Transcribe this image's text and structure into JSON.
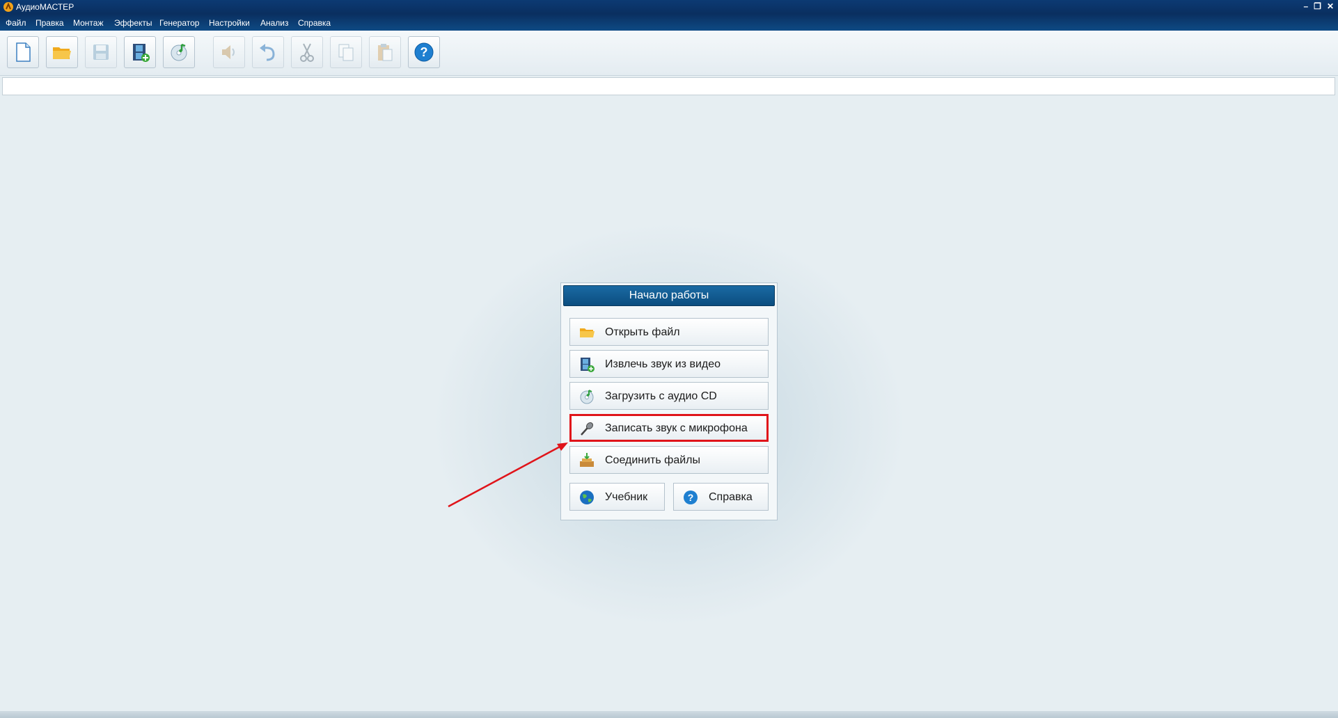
{
  "window": {
    "title": "АудиоМАСТЕР",
    "controls": [
      "–",
      "❐",
      "✕"
    ]
  },
  "menu": [
    "Файл",
    "Правка",
    "Монтаж",
    "Эффекты",
    "Генератор",
    "Настройки",
    "Анализ",
    "Справка"
  ],
  "toolbar": [
    {
      "icon": "new-file-icon",
      "enabled": true
    },
    {
      "icon": "open-folder-icon",
      "enabled": true
    },
    {
      "icon": "save-icon",
      "enabled": false
    },
    {
      "icon": "video-add-icon",
      "enabled": true
    },
    {
      "icon": "audio-cd-icon",
      "enabled": true
    },
    {
      "icon": "speaker-icon",
      "enabled": false
    },
    {
      "icon": "undo-icon",
      "enabled": false
    },
    {
      "icon": "cut-icon",
      "enabled": false
    },
    {
      "icon": "copy-icon",
      "enabled": false
    },
    {
      "icon": "paste-icon",
      "enabled": false
    },
    {
      "icon": "help-icon",
      "enabled": true
    }
  ],
  "start_panel": {
    "title": "Начало работы",
    "buttons": [
      {
        "label": "Открыть файл",
        "icon": "folder-icon"
      },
      {
        "label": "Извлечь звук из видео",
        "icon": "video-icon"
      },
      {
        "label": "Загрузить с аудио CD",
        "icon": "cd-icon"
      },
      {
        "label": "Записать звук с микрофона",
        "icon": "microphone-icon",
        "highlighted": true
      },
      {
        "label": "Соединить файлы",
        "icon": "join-files-icon"
      }
    ],
    "bottom_buttons": [
      {
        "label": "Учебник",
        "icon": "globe-icon"
      },
      {
        "label": "Справка",
        "icon": "help-icon"
      }
    ]
  },
  "colors": {
    "highlight": "#e0141a",
    "arrow": "#e0141a",
    "header": "#0b4e80"
  }
}
